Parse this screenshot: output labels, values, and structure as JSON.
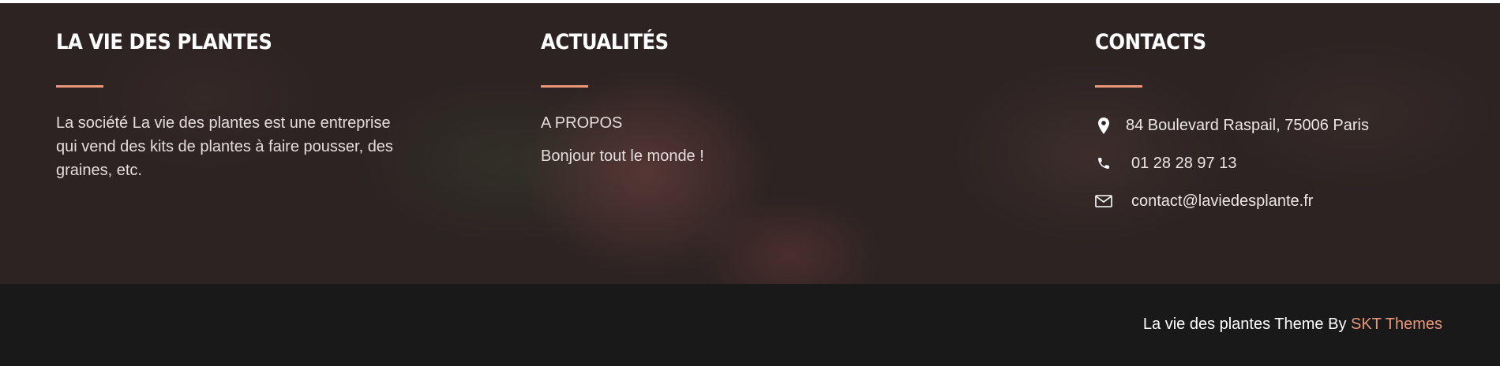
{
  "about": {
    "title": "LA VIE DES PLANTES",
    "text": "La société La vie des plantes est une entreprise qui vend des kits de plantes à faire pousser, des graines, etc."
  },
  "news": {
    "title": "ACTUALITÉS",
    "items": [
      "A PROPOS",
      "Bonjour tout le monde !"
    ]
  },
  "contact": {
    "title": "CONTACTS",
    "address": "84 Boulevard Raspail, 75006 Paris",
    "phone": "01 28 28 97 13",
    "email": "contact@laviedesplante.fr",
    "icons": {
      "address": "map-pin-icon",
      "phone": "phone-icon",
      "email": "envelope-icon"
    }
  },
  "copyright": {
    "text": "La vie des plantes Theme By",
    "link_label": "SKT Themes"
  },
  "colors": {
    "accent": "#e9967a",
    "footer_bottom_bg": "#191919",
    "footer_top_bg": "#2c2322"
  }
}
